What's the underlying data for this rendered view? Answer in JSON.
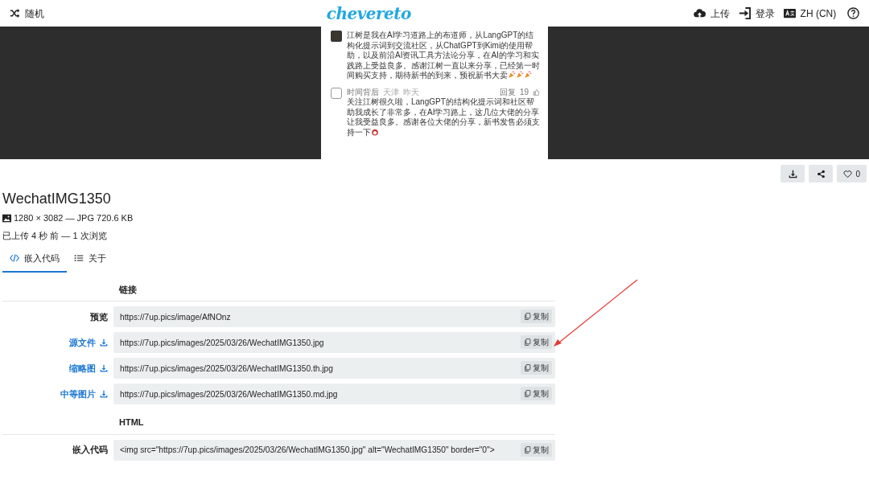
{
  "header": {
    "random": "随机",
    "logo": "chevereto",
    "upload": "上传",
    "login": "登录",
    "language": "ZH (CN)"
  },
  "preview": {
    "comments": [
      {
        "text": "江树是我在AI学习道路上的布道师，从LangGPT的结构化提示词到交流社区，从ChatGPT到Kimi的使用帮助，以及前沿AI资讯工具方法论分享，在AI的学习和实践路上受益良多。感谢江树一直以来分享，已经第一时间购买支持，期待新书的到来，预祝新书大卖"
      },
      {
        "user": "时间背后",
        "location": "天津",
        "time": "昨天",
        "reply": "回复",
        "likes": "19",
        "text": "关注江树很久啦，LangGPT的结构化提示词和社区帮助我成长了非常多，在AI学习路上，这几位大佬的分享让我受益良多。感谢各位大佬的分享，新书发售必须支持一下"
      }
    ]
  },
  "actions": {
    "likes": "0"
  },
  "image": {
    "title": "WechatIMG1350",
    "meta": "1280 × 3082 — JPG 720.6 KB",
    "stats": "已上传 4 秒 前 — 1 次浏览"
  },
  "tabs": [
    {
      "label": "嵌入代码",
      "selected": true,
      "kind": "code"
    },
    {
      "label": "关于",
      "selected": false,
      "kind": "list"
    }
  ],
  "sections": [
    {
      "heading": "链接",
      "rows": [
        {
          "label": "预览",
          "download": false,
          "value": "https://7up.pics/image/AfNOnz",
          "copy": "复制"
        },
        {
          "label": "源文件",
          "download": true,
          "value": "https://7up.pics/images/2025/03/26/WechatIMG1350.jpg",
          "copy": "复制"
        },
        {
          "label": "缩略图",
          "download": true,
          "value": "https://7up.pics/images/2025/03/26/WechatIMG1350.th.jpg",
          "copy": "复制"
        },
        {
          "label": "中等图片",
          "download": true,
          "value": "https://7up.pics/images/2025/03/26/WechatIMG1350.md.jpg",
          "copy": "复制"
        }
      ]
    },
    {
      "heading": "HTML",
      "rows": [
        {
          "label": "嵌入代码",
          "download": false,
          "value": "<img src=\"https://7up.pics/images/2025/03/26/WechatIMG1350.jpg\" alt=\"WechatIMG1350\" border=\"0\">",
          "copy": "复制"
        }
      ]
    }
  ]
}
